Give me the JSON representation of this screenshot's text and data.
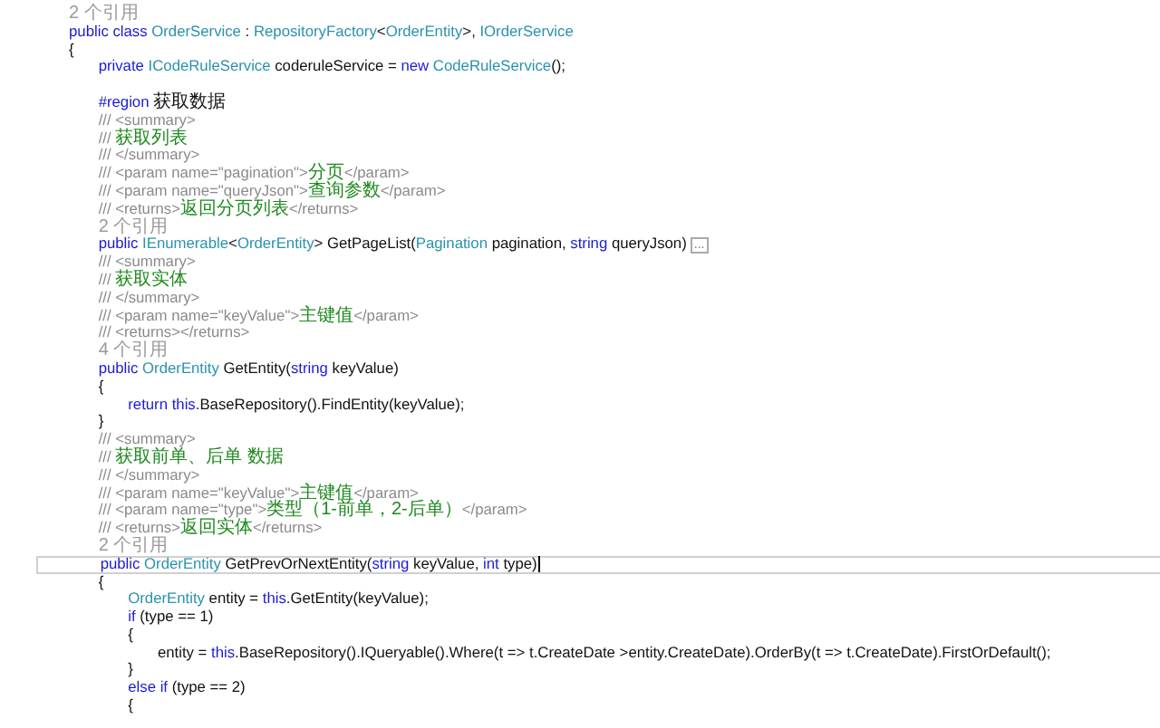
{
  "editor": {
    "lines": [
      {
        "kind": "lens",
        "selected": false,
        "tokens": [
          {
            "kind": "comment",
            "text": "2 个引用"
          }
        ]
      },
      {
        "kind": "code",
        "selected": false,
        "tokens": [
          {
            "kind": "keyword",
            "text": "public class "
          },
          {
            "kind": "type",
            "text": "OrderService"
          },
          {
            "kind": "plain",
            "text": " : "
          },
          {
            "kind": "type",
            "text": "RepositoryFactory"
          },
          {
            "kind": "plain",
            "text": "<"
          },
          {
            "kind": "type",
            "text": "OrderEntity"
          },
          {
            "kind": "plain",
            "text": ">, "
          },
          {
            "kind": "type",
            "text": "IOrderService"
          }
        ]
      },
      {
        "kind": "code",
        "selected": false,
        "tokens": [
          {
            "kind": "plain",
            "text": "{"
          }
        ]
      },
      {
        "kind": "code",
        "selected": false,
        "tokens": [
          {
            "kind": "keyword",
            "text": "    private "
          },
          {
            "kind": "type",
            "text": "ICodeRuleService"
          },
          {
            "kind": "plain",
            "text": " coderuleService = "
          },
          {
            "kind": "keyword",
            "text": "new "
          },
          {
            "kind": "type",
            "text": "CodeRuleService"
          },
          {
            "kind": "plain",
            "text": "();"
          }
        ]
      },
      {
        "kind": "blank",
        "selected": false
      },
      {
        "kind": "code",
        "selected": false,
        "tokens": [
          {
            "kind": "keyword",
            "text": "    #region "
          },
          {
            "kind": "heading",
            "text": "获取数据"
          }
        ]
      },
      {
        "kind": "code",
        "selected": false,
        "tokens": [
          {
            "kind": "comment",
            "text": "    /// <summary>"
          }
        ]
      },
      {
        "kind": "code",
        "selected": false,
        "tokens": [
          {
            "kind": "comment",
            "text": "    /// "
          },
          {
            "kind": "doc",
            "text": "获取列表"
          }
        ]
      },
      {
        "kind": "code",
        "selected": false,
        "tokens": [
          {
            "kind": "comment",
            "text": "    /// </summary>"
          }
        ]
      },
      {
        "kind": "code",
        "selected": false,
        "tokens": [
          {
            "kind": "comment",
            "text": "    /// <param name=\"pagination\">"
          },
          {
            "kind": "doc",
            "text": "分页"
          },
          {
            "kind": "comment",
            "text": "</param>"
          }
        ]
      },
      {
        "kind": "code",
        "selected": false,
        "tokens": [
          {
            "kind": "comment",
            "text": "    /// <param name=\"queryJson\">"
          },
          {
            "kind": "doc",
            "text": "查询参数"
          },
          {
            "kind": "comment",
            "text": "</param>"
          }
        ]
      },
      {
        "kind": "code",
        "selected": false,
        "tokens": [
          {
            "kind": "comment",
            "text": "    /// <returns>"
          },
          {
            "kind": "doc",
            "text": "返回分页列表"
          },
          {
            "kind": "comment",
            "text": "</returns>"
          }
        ]
      },
      {
        "kind": "lens",
        "selected": false,
        "tokens": [
          {
            "kind": "comment",
            "text": "    2 个引用"
          }
        ]
      },
      {
        "kind": "code",
        "selected": false,
        "fold": "...",
        "tokens": [
          {
            "kind": "keyword",
            "text": "    public "
          },
          {
            "kind": "type",
            "text": "IEnumerable"
          },
          {
            "kind": "plain",
            "text": "<"
          },
          {
            "kind": "type",
            "text": "OrderEntity"
          },
          {
            "kind": "plain",
            "text": "> GetPageList("
          },
          {
            "kind": "type",
            "text": "Pagination"
          },
          {
            "kind": "plain",
            "text": " pagination, "
          },
          {
            "kind": "keyword",
            "text": "string "
          },
          {
            "kind": "plain",
            "text": "queryJson)"
          }
        ]
      },
      {
        "kind": "code",
        "selected": false,
        "tokens": [
          {
            "kind": "comment",
            "text": "    /// <summary>"
          }
        ]
      },
      {
        "kind": "code",
        "selected": false,
        "tokens": [
          {
            "kind": "comment",
            "text": "    /// "
          },
          {
            "kind": "doc",
            "text": "获取实体"
          }
        ]
      },
      {
        "kind": "code",
        "selected": false,
        "tokens": [
          {
            "kind": "comment",
            "text": "    /// </summary>"
          }
        ]
      },
      {
        "kind": "code",
        "selected": false,
        "tokens": [
          {
            "kind": "comment",
            "text": "    /// <param name=\"keyValue\">"
          },
          {
            "kind": "doc",
            "text": "主键值"
          },
          {
            "kind": "comment",
            "text": "</param>"
          }
        ]
      },
      {
        "kind": "code",
        "selected": false,
        "tokens": [
          {
            "kind": "comment",
            "text": "    /// <returns></returns>"
          }
        ]
      },
      {
        "kind": "lens",
        "selected": false,
        "tokens": [
          {
            "kind": "comment",
            "text": "    4 个引用"
          }
        ]
      },
      {
        "kind": "code",
        "selected": false,
        "tokens": [
          {
            "kind": "keyword",
            "text": "    public "
          },
          {
            "kind": "type",
            "text": "OrderEntity"
          },
          {
            "kind": "plain",
            "text": " GetEntity("
          },
          {
            "kind": "keyword",
            "text": "string "
          },
          {
            "kind": "plain",
            "text": "keyValue)"
          }
        ]
      },
      {
        "kind": "code",
        "selected": false,
        "tokens": [
          {
            "kind": "plain",
            "text": "    {"
          }
        ]
      },
      {
        "kind": "code",
        "selected": false,
        "tokens": [
          {
            "kind": "keyword",
            "text": "        return this"
          },
          {
            "kind": "plain",
            "text": ".BaseRepository().FindEntity(keyValue);"
          }
        ]
      },
      {
        "kind": "code",
        "selected": false,
        "tokens": [
          {
            "kind": "plain",
            "text": "    }"
          }
        ]
      },
      {
        "kind": "code",
        "selected": false,
        "tokens": [
          {
            "kind": "comment",
            "text": "    /// <summary>"
          }
        ]
      },
      {
        "kind": "code",
        "selected": false,
        "tokens": [
          {
            "kind": "comment",
            "text": "    /// "
          },
          {
            "kind": "doc",
            "text": "获取前单、后单 数据"
          }
        ]
      },
      {
        "kind": "code",
        "selected": false,
        "tokens": [
          {
            "kind": "comment",
            "text": "    /// </summary>"
          }
        ]
      },
      {
        "kind": "code",
        "selected": false,
        "tokens": [
          {
            "kind": "comment",
            "text": "    /// <param name=\"keyValue\">"
          },
          {
            "kind": "doc",
            "text": "主键值"
          },
          {
            "kind": "comment",
            "text": "</param>"
          }
        ]
      },
      {
        "kind": "code",
        "selected": false,
        "tokens": [
          {
            "kind": "comment",
            "text": "    /// <param name=\"type\">"
          },
          {
            "kind": "doc",
            "text": "类型（1-前单，2-后单）"
          },
          {
            "kind": "comment",
            "text": "</param>"
          }
        ]
      },
      {
        "kind": "code",
        "selected": false,
        "tokens": [
          {
            "kind": "comment",
            "text": "    /// <returns>"
          },
          {
            "kind": "doc",
            "text": "返回实体"
          },
          {
            "kind": "comment",
            "text": "</returns>"
          }
        ]
      },
      {
        "kind": "lens",
        "selected": false,
        "tokens": [
          {
            "kind": "comment",
            "text": "    2 个引用"
          }
        ]
      },
      {
        "kind": "code",
        "selected": true,
        "tokens": [
          {
            "kind": "keyword",
            "text": "    public "
          },
          {
            "kind": "type",
            "text": "OrderEntity"
          },
          {
            "kind": "plain",
            "text": " GetPrevOrNextEntity("
          },
          {
            "kind": "keyword",
            "text": "string "
          },
          {
            "kind": "plain",
            "text": "keyValue, "
          },
          {
            "kind": "keyword",
            "text": "int "
          },
          {
            "kind": "plain",
            "text": "type)"
          }
        ]
      },
      {
        "kind": "code",
        "selected": false,
        "tokens": [
          {
            "kind": "plain",
            "text": "    {"
          }
        ]
      },
      {
        "kind": "code",
        "selected": false,
        "tokens": [
          {
            "kind": "type",
            "text": "        OrderEntity"
          },
          {
            "kind": "plain",
            "text": " entity = "
          },
          {
            "kind": "keyword",
            "text": "this"
          },
          {
            "kind": "plain",
            "text": ".GetEntity(keyValue);"
          }
        ]
      },
      {
        "kind": "code",
        "selected": false,
        "tokens": [
          {
            "kind": "keyword",
            "text": "        if "
          },
          {
            "kind": "plain",
            "text": "(type == 1)"
          }
        ]
      },
      {
        "kind": "code",
        "selected": false,
        "tokens": [
          {
            "kind": "plain",
            "text": "        {"
          }
        ]
      },
      {
        "kind": "code",
        "selected": false,
        "tokens": [
          {
            "kind": "plain",
            "text": "            entity = "
          },
          {
            "kind": "keyword",
            "text": "this"
          },
          {
            "kind": "plain",
            "text": ".BaseRepository().IQueryable().Where(t => t.CreateDate >entity.CreateDate).OrderBy(t => t.CreateDate).FirstOrDefault();"
          }
        ]
      },
      {
        "kind": "code",
        "selected": false,
        "tokens": [
          {
            "kind": "plain",
            "text": "        }"
          }
        ]
      },
      {
        "kind": "code",
        "selected": false,
        "tokens": [
          {
            "kind": "keyword",
            "text": "        else if "
          },
          {
            "kind": "plain",
            "text": "(type == 2)"
          }
        ]
      },
      {
        "kind": "code",
        "selected": false,
        "tokens": [
          {
            "kind": "plain",
            "text": "        {"
          }
        ]
      }
    ]
  }
}
